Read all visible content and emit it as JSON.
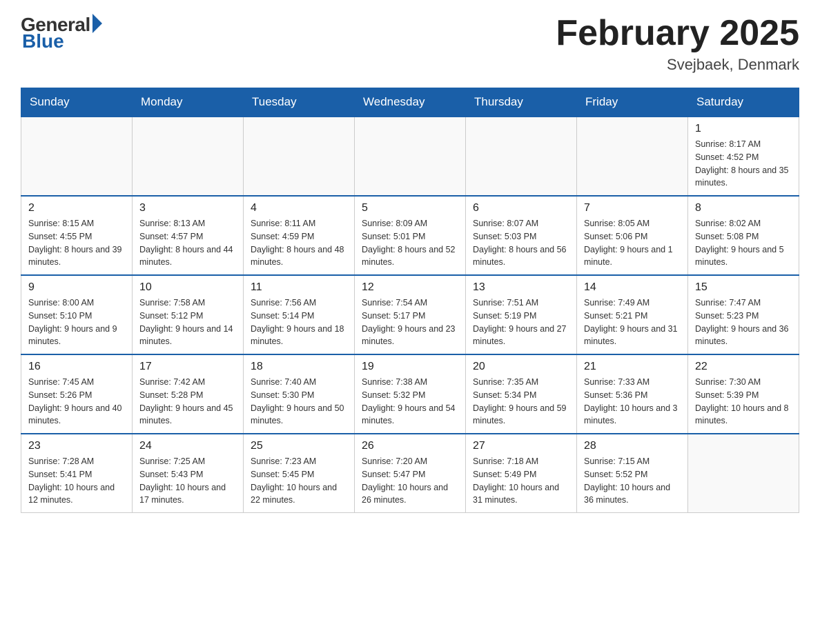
{
  "logo": {
    "general": "General",
    "blue": "Blue"
  },
  "title": {
    "month": "February 2025",
    "location": "Svejbaek, Denmark"
  },
  "days_of_week": [
    "Sunday",
    "Monday",
    "Tuesday",
    "Wednesday",
    "Thursday",
    "Friday",
    "Saturday"
  ],
  "weeks": [
    [
      null,
      null,
      null,
      null,
      null,
      null,
      {
        "day": "1",
        "sunrise": "8:17 AM",
        "sunset": "4:52 PM",
        "daylight": "8 hours and 35 minutes."
      }
    ],
    [
      {
        "day": "2",
        "sunrise": "8:15 AM",
        "sunset": "4:55 PM",
        "daylight": "8 hours and 39 minutes."
      },
      {
        "day": "3",
        "sunrise": "8:13 AM",
        "sunset": "4:57 PM",
        "daylight": "8 hours and 44 minutes."
      },
      {
        "day": "4",
        "sunrise": "8:11 AM",
        "sunset": "4:59 PM",
        "daylight": "8 hours and 48 minutes."
      },
      {
        "day": "5",
        "sunrise": "8:09 AM",
        "sunset": "5:01 PM",
        "daylight": "8 hours and 52 minutes."
      },
      {
        "day": "6",
        "sunrise": "8:07 AM",
        "sunset": "5:03 PM",
        "daylight": "8 hours and 56 minutes."
      },
      {
        "day": "7",
        "sunrise": "8:05 AM",
        "sunset": "5:06 PM",
        "daylight": "9 hours and 1 minute."
      },
      {
        "day": "8",
        "sunrise": "8:02 AM",
        "sunset": "5:08 PM",
        "daylight": "9 hours and 5 minutes."
      }
    ],
    [
      {
        "day": "9",
        "sunrise": "8:00 AM",
        "sunset": "5:10 PM",
        "daylight": "9 hours and 9 minutes."
      },
      {
        "day": "10",
        "sunrise": "7:58 AM",
        "sunset": "5:12 PM",
        "daylight": "9 hours and 14 minutes."
      },
      {
        "day": "11",
        "sunrise": "7:56 AM",
        "sunset": "5:14 PM",
        "daylight": "9 hours and 18 minutes."
      },
      {
        "day": "12",
        "sunrise": "7:54 AM",
        "sunset": "5:17 PM",
        "daylight": "9 hours and 23 minutes."
      },
      {
        "day": "13",
        "sunrise": "7:51 AM",
        "sunset": "5:19 PM",
        "daylight": "9 hours and 27 minutes."
      },
      {
        "day": "14",
        "sunrise": "7:49 AM",
        "sunset": "5:21 PM",
        "daylight": "9 hours and 31 minutes."
      },
      {
        "day": "15",
        "sunrise": "7:47 AM",
        "sunset": "5:23 PM",
        "daylight": "9 hours and 36 minutes."
      }
    ],
    [
      {
        "day": "16",
        "sunrise": "7:45 AM",
        "sunset": "5:26 PM",
        "daylight": "9 hours and 40 minutes."
      },
      {
        "day": "17",
        "sunrise": "7:42 AM",
        "sunset": "5:28 PM",
        "daylight": "9 hours and 45 minutes."
      },
      {
        "day": "18",
        "sunrise": "7:40 AM",
        "sunset": "5:30 PM",
        "daylight": "9 hours and 50 minutes."
      },
      {
        "day": "19",
        "sunrise": "7:38 AM",
        "sunset": "5:32 PM",
        "daylight": "9 hours and 54 minutes."
      },
      {
        "day": "20",
        "sunrise": "7:35 AM",
        "sunset": "5:34 PM",
        "daylight": "9 hours and 59 minutes."
      },
      {
        "day": "21",
        "sunrise": "7:33 AM",
        "sunset": "5:36 PM",
        "daylight": "10 hours and 3 minutes."
      },
      {
        "day": "22",
        "sunrise": "7:30 AM",
        "sunset": "5:39 PM",
        "daylight": "10 hours and 8 minutes."
      }
    ],
    [
      {
        "day": "23",
        "sunrise": "7:28 AM",
        "sunset": "5:41 PM",
        "daylight": "10 hours and 12 minutes."
      },
      {
        "day": "24",
        "sunrise": "7:25 AM",
        "sunset": "5:43 PM",
        "daylight": "10 hours and 17 minutes."
      },
      {
        "day": "25",
        "sunrise": "7:23 AM",
        "sunset": "5:45 PM",
        "daylight": "10 hours and 22 minutes."
      },
      {
        "day": "26",
        "sunrise": "7:20 AM",
        "sunset": "5:47 PM",
        "daylight": "10 hours and 26 minutes."
      },
      {
        "day": "27",
        "sunrise": "7:18 AM",
        "sunset": "5:49 PM",
        "daylight": "10 hours and 31 minutes."
      },
      {
        "day": "28",
        "sunrise": "7:15 AM",
        "sunset": "5:52 PM",
        "daylight": "10 hours and 36 minutes."
      },
      null
    ]
  ]
}
